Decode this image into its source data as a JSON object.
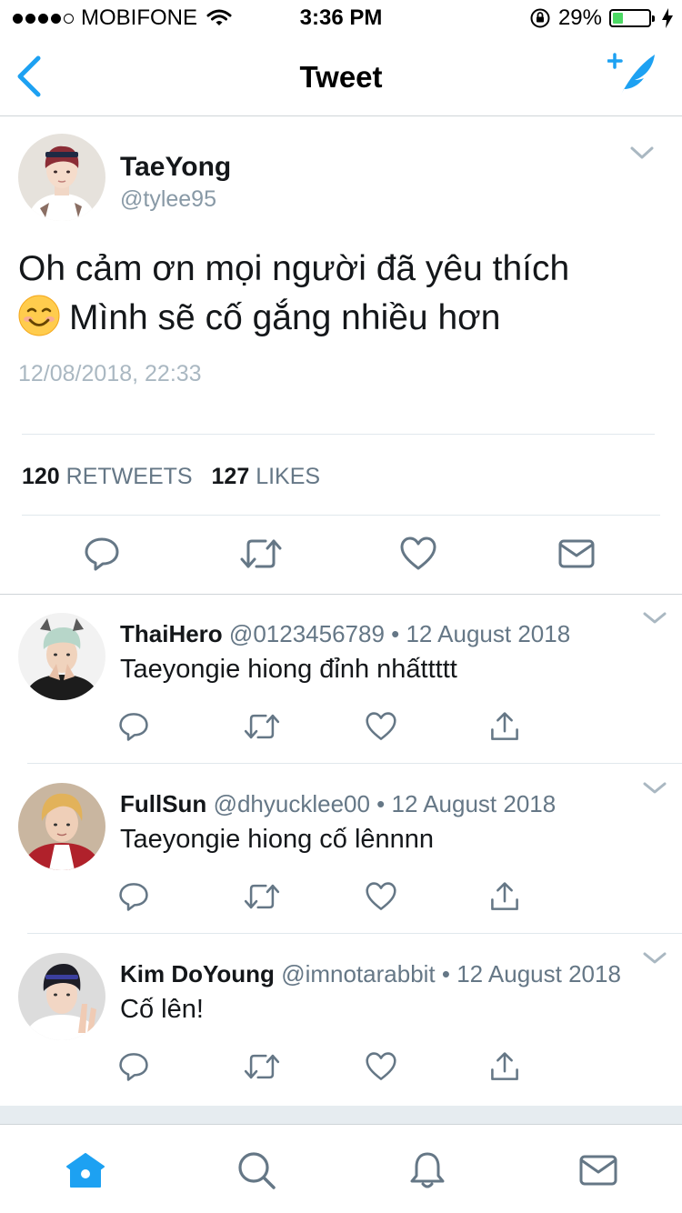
{
  "status_bar": {
    "carrier": "MOBIFONE",
    "time": "3:36 PM",
    "battery": "29%",
    "battery_level": 0.29,
    "battery_color": "#4cd964"
  },
  "nav": {
    "title": "Tweet",
    "back_icon": "chevron-left-icon",
    "compose_icon": "compose-feather-icon",
    "accent": "#1da1f2"
  },
  "tweet": {
    "name": "TaeYong",
    "handle": "@tylee95",
    "text_line1": "Oh cảm ơn mọi người đã yêu thích",
    "text_line2": "Mình sẽ cố gắng nhiều hơn",
    "emoji": "smiling-face-emoji",
    "date": "12/08/2018, 22:33",
    "retweets_count": "120",
    "retweets_label": "RETWEETS",
    "likes_count": "127",
    "likes_label": "LIKES"
  },
  "replies": [
    {
      "name": "ThaiHero",
      "meta": "@0123456789 • 12 August 2018",
      "text": "Taeyongie hiong đỉnh nhấttttt"
    },
    {
      "name": "FullSun",
      "meta": "@dhyucklee00 • 12 August 2018",
      "text": "Taeyongie hiong cố lênnnn"
    },
    {
      "name": "Kim DoYoung",
      "meta": "@imnotarabbit • 12 August 2018",
      "text": "Cố lên!"
    }
  ],
  "tab_bar": {
    "items": [
      "home-icon",
      "search-icon",
      "notifications-icon",
      "messages-icon"
    ],
    "active": "home-icon"
  }
}
